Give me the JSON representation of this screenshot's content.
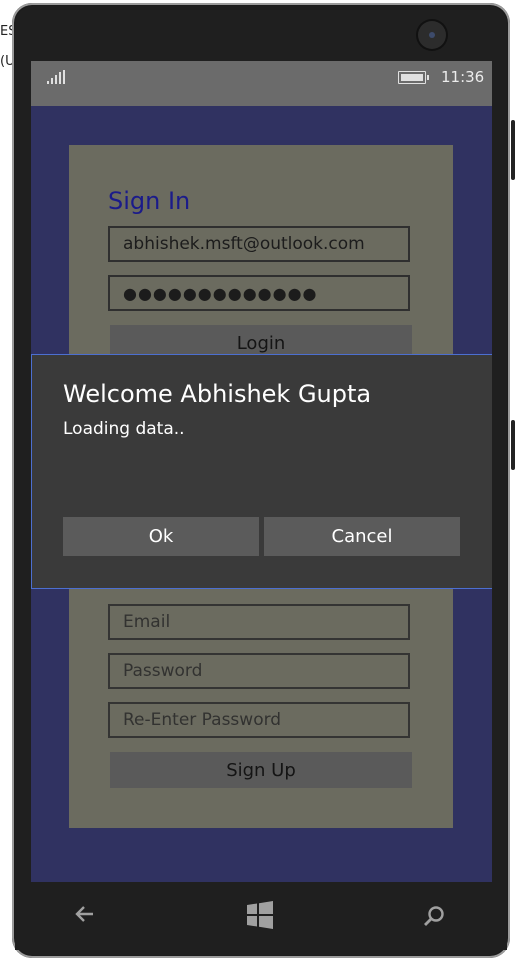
{
  "status_bar": {
    "time": "11:36",
    "signal_icon": "signal-bars-icon",
    "battery_icon": "battery-charging-icon"
  },
  "signin": {
    "title": "Sign In",
    "email_value": "abhishek.msft@outlook.com",
    "password_value": "●●●●●●●●●●●●●",
    "login_label": "Login"
  },
  "signup": {
    "email_placeholder": "Email",
    "password_placeholder": "Password",
    "reenter_placeholder": "Re-Enter Password",
    "signup_label": "Sign Up"
  },
  "dialog": {
    "title": "Welcome Abhishek Gupta",
    "message": "Loading data..",
    "ok_label": "Ok",
    "cancel_label": "Cancel"
  },
  "navbar": {
    "back_icon": "back-arrow-icon",
    "home_icon": "windows-logo-icon",
    "search_icon": "search-icon"
  },
  "side_texts": [
    "ES",
    "(U"
  ],
  "colors": {
    "accent_border": "#4c6fd1",
    "title_color": "#1b1b8a",
    "screen_bg": "#303261"
  }
}
